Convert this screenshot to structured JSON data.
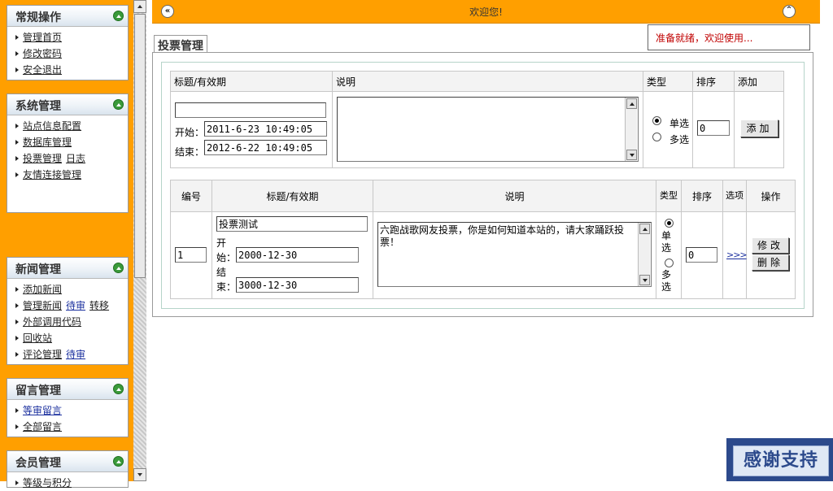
{
  "sidebar": {
    "general": {
      "title": "常规操作",
      "items": [
        {
          "links": [
            "管理首页"
          ]
        },
        {
          "links": [
            "修改密码"
          ]
        },
        {
          "links": [
            "安全退出"
          ]
        }
      ]
    },
    "system": {
      "title": "系统管理",
      "items": [
        {
          "links": [
            "站点信息配置"
          ]
        },
        {
          "links": [
            "数据库管理"
          ]
        },
        {
          "links": [
            "投票管理",
            "日志"
          ]
        },
        {
          "links": [
            "友情连接管理"
          ]
        }
      ]
    },
    "news": {
      "title": "新闻管理",
      "items": [
        {
          "links": [
            "添加新闻"
          ]
        },
        {
          "links": [
            "管理新闻",
            "待审",
            "转移"
          ]
        },
        {
          "links": [
            "外部调用代码"
          ]
        },
        {
          "links": [
            "回收站"
          ]
        },
        {
          "links": [
            "评论管理",
            "待审"
          ]
        }
      ]
    },
    "messages": {
      "title": "留言管理",
      "items": [
        {
          "links": [
            "等审留言"
          ]
        },
        {
          "links": [
            "全部留言"
          ]
        }
      ]
    },
    "members": {
      "title": "会员管理",
      "items": [
        {
          "links": [
            "等级与积分"
          ]
        }
      ]
    }
  },
  "topbar": {
    "left_icon": "double-chevron-left-icon",
    "welcome": "欢迎您!",
    "right_icon": "double-chevron-up-icon"
  },
  "status": "准备就绪，欢迎使用...",
  "vote": {
    "tab_title": "投票管理",
    "add_form": {
      "headers": {
        "title": "标题/有效期",
        "desc": "说明",
        "type": "类型",
        "order": "排序",
        "add": "添加"
      },
      "title_value": "",
      "start_label": "开始：",
      "start_value": "2011-6-23 10:49:05",
      "end_label": "结束：",
      "end_value": "2012-6-22 10:49:05",
      "desc_value": "",
      "type_single": "单选",
      "type_multi": "多选",
      "order_value": "0",
      "add_button": "添加"
    },
    "list": {
      "headers": {
        "id": "编号",
        "title": "标题/有效期",
        "desc": "说明",
        "type": "类型",
        "order": "排序",
        "options": "选项",
        "action": "操作"
      },
      "rows": [
        {
          "id": "1",
          "title": "投票测试",
          "start_label": "开始：",
          "start_value": "2000-12-30",
          "end_label": "结束：",
          "end_value": "3000-12-30",
          "desc": "六跑战歌网友投票，你是如何知道本站的，请大家踊跃投票！",
          "type_single": "单选",
          "type_multi": "多选",
          "order": "0",
          "options_link": ">>>",
          "edit_button": "修改",
          "delete_button": "删除"
        }
      ]
    }
  },
  "support_banner": "感谢支持",
  "colors": {
    "accent": "#ff9f00",
    "status_text": "#c00000",
    "link_blue": "#1a2f9e"
  }
}
